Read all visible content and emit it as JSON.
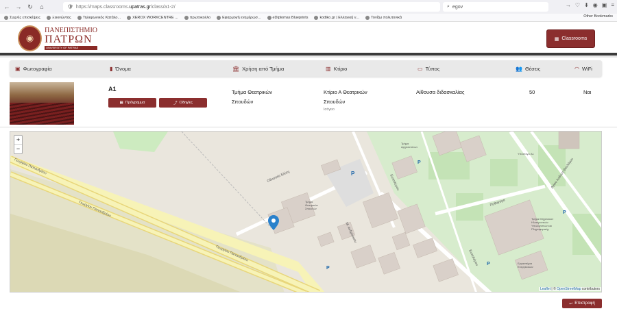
{
  "browser": {
    "url_prefix": "https://maps.classrooms.",
    "url_domain": "upatras.gr",
    "url_path": "/class/a1-2/",
    "search_value": "egov",
    "bookmarks": [
      "Συχνές επισκέψεις",
      "Ξεκινώντας",
      "Τηλεφωνικός Κατάλο...",
      "XEROX WORKCENTRE ...",
      "πρωτοκολλο",
      "Εφαρμογή ενημέρωσ...",
      "eDiplomas Blueprints",
      "kodiko.gr | Ελληνική ν...",
      "Τονίζω πολυτονικά"
    ],
    "other_bookmarks": "Other Bookmarks"
  },
  "header": {
    "logo_line1": "ΠΑΝΕΠΙΣΤΗΜΙΟ",
    "logo_line2": "ΠΑΤΡΩΝ",
    "logo_line3": "UNIVERSITY OF PATRAS",
    "classrooms_label": "Classrooms"
  },
  "columns": {
    "photo": "Φωτογραφία",
    "name": "Όνομα",
    "use": "Χρήση από Τμήμα",
    "building": "Κτίριο",
    "type": "Τύπος",
    "seats": "Θέσεις",
    "wifi": "WiFi"
  },
  "room": {
    "name": "A1",
    "schedule_label": "Πρόγραμμα",
    "directions_label": "Οδηγίες",
    "department_line1": "Τμήμα Θεατρικών",
    "department_line2": "Σπουδών",
    "building_line1": "Κτίριο Α Θεατρικών",
    "building_line2": "Σπουδών",
    "floor": "Ισόγειο",
    "type": "Αίθουσα διδασκαλίας",
    "seats": "50",
    "wifi": "Ναι"
  },
  "map": {
    "zoom_in": "+",
    "zoom_out": "−",
    "attribution_leaflet": "Leaflet",
    "attribution_sep": " | © ",
    "attribution_osm": "OpenStreetMap",
    "attribution_tail": " contributors",
    "labels": {
      "road1": "Γεωργίου Παπανδρέου",
      "road2": "Οδυσσέα Ελύτη",
      "road3": "Μ. Ανδρόνικου",
      "road4": "Ευπολέμου",
      "road5": "Πυθαγόρα",
      "road6": "Αγίου Ιωάννη Θεολόγου",
      "building": "Τμήμα Θεατρικών Σπουδών",
      "building2": "Τμήμα Μηχανικών Ηλεκτρονικών Υπολογιστών και Πληροφορικής",
      "building3": "Εργαστήρια Ενεργειακών",
      "building4": "Υπόστεγο A1",
      "building5": "Τμήμα Αρχιτεκτόνων",
      "parking": "P"
    }
  },
  "footer": {
    "back_label": "Επιστροφή"
  },
  "colors": {
    "brand": "#8b2e2e"
  }
}
